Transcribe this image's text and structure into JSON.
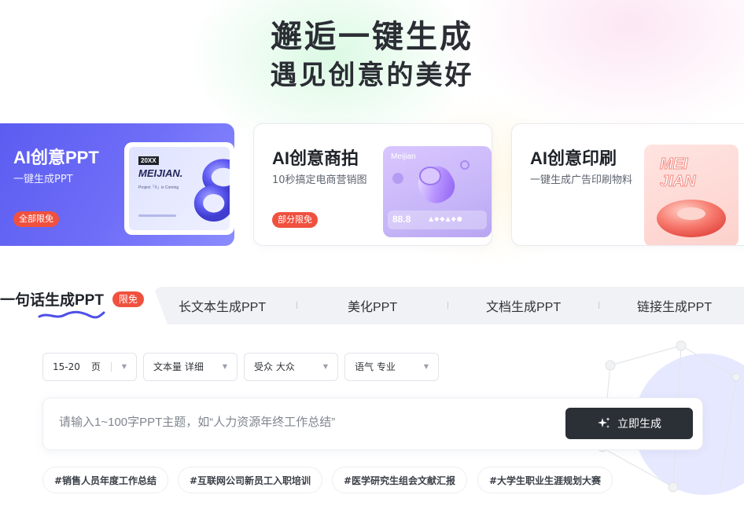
{
  "hero": {
    "line1": "邂逅一键生成",
    "line2": "遇见创意的美好"
  },
  "cards": [
    {
      "title": "AI创意PPT",
      "subtitle": "一键生成PPT",
      "badge": "全部限免",
      "img_text_top": "20XX",
      "img_text_main": "MEIJIAN.",
      "img_text_sub": "Project「X」is Coming"
    },
    {
      "title": "AI创意商拍",
      "subtitle": "10秒搞定电商营销图",
      "badge": "部分限免",
      "img_label": "Meijian",
      "img_price": "88.8"
    },
    {
      "title": "AI创意印刷",
      "subtitle": "一键生成广告印刷物料",
      "img_text": "MEI JIAN"
    }
  ],
  "tabs": {
    "active": "一句话生成PPT",
    "active_badge": "限免",
    "items": [
      "长文本生成PPT",
      "美化PPT",
      "文档生成PPT",
      "链接生成PPT"
    ]
  },
  "selectors": [
    {
      "value": "15-20",
      "unit": "页"
    },
    {
      "label": "文本量",
      "value": "详细"
    },
    {
      "label": "受众",
      "value": "大众"
    },
    {
      "label": "语气",
      "value": "专业"
    }
  ],
  "prompt": {
    "placeholder": "请输入1~100字PPT主题，如“人力资源年终工作总结”",
    "button": "立即生成"
  },
  "hashtags": [
    "#销售人员年度工作总结",
    "#互联网公司新员工入职培训",
    "#医学研究生组会文献汇报",
    "#大学生职业生涯规划大赛"
  ],
  "colors": {
    "accent": "#5b5cf0",
    "badge": "#f0513f",
    "button": "#2b2f36"
  }
}
